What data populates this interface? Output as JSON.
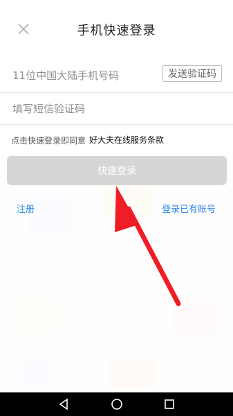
{
  "header": {
    "title": "手机快速登录"
  },
  "phone_field": {
    "value": "",
    "placeholder": "11位中国大陆手机号码"
  },
  "send_code_button": {
    "label": "发送验证码"
  },
  "code_field": {
    "value": "",
    "placeholder": "填写短信验证码"
  },
  "agreement": {
    "text": "点击快速登录即同意",
    "link_text": "好大夫在线服务条款"
  },
  "submit_button": {
    "label": "快速登录"
  },
  "links": {
    "register": "注册",
    "login_existing": "登录已有账号"
  },
  "icons": {
    "close": "close-icon",
    "annotation_arrow": "red-arrow-icon",
    "nav_back": "back-triangle-icon",
    "nav_home": "home-circle-icon",
    "nav_recent": "recent-square-icon"
  },
  "colors": {
    "link_blue": "#2f8be6",
    "button_disabled_bg": "#d6d6d6",
    "arrow_red": "#ef1d26"
  }
}
